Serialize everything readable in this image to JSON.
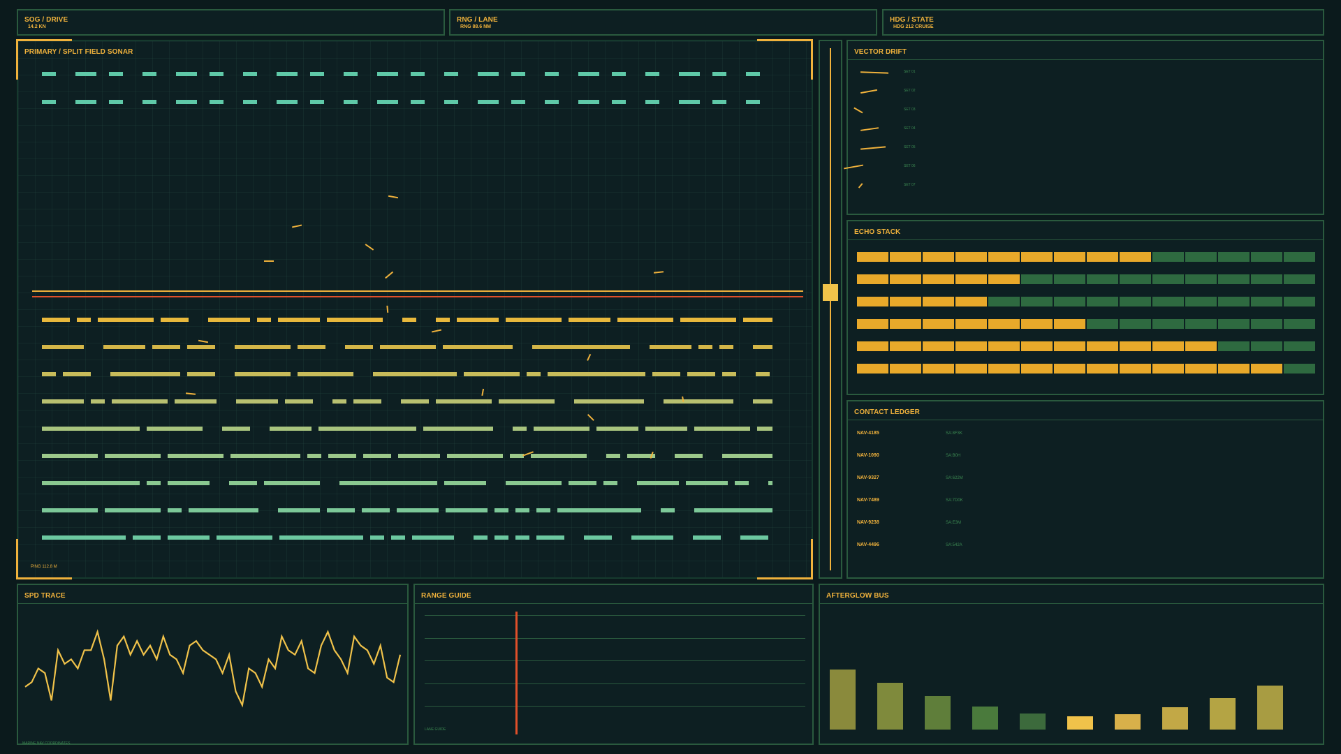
{
  "top_bar": [
    {
      "title": "SOG / DRIVE",
      "value": "14.2 KN"
    },
    {
      "title": "RNG / LANE",
      "value": "RNG 88.6 NM"
    },
    {
      "title": "HDG / STATE",
      "value": "HDG 212 CRUISE"
    }
  ],
  "sonar": {
    "title": "PRIMARY  /  SPLIT FIELD SONAR",
    "footer": "PING 112.8 M"
  },
  "vector_drift": {
    "title": "VECTOR DRIFT",
    "sets": [
      "SET 01",
      "SET 02",
      "SET 03",
      "SET 04",
      "SET 05",
      "SET 06",
      "SET 07"
    ]
  },
  "echo_stack": {
    "title": "ECHO STACK",
    "rows": [
      9,
      5,
      4,
      7,
      11,
      13
    ],
    "total": 14
  },
  "contact_ledger": {
    "title": "CONTACT LEDGER",
    "rows": [
      {
        "id": "NAV-4185",
        "val": "SA:8F3K"
      },
      {
        "id": "NAV-1090",
        "val": "SA:B0H"
      },
      {
        "id": "NAV-9327",
        "val": "SA:622M"
      },
      {
        "id": "NAV-7489",
        "val": "SA:7D0K"
      },
      {
        "id": "NAV-9238",
        "val": "SA:E3M"
      },
      {
        "id": "NAV-4496",
        "val": "SA:542A"
      }
    ]
  },
  "spd_trace": {
    "title": "SPD TRACE",
    "footer": "MARINE NAV COORDINATES",
    "values": [
      4,
      5,
      8,
      7,
      1,
      12,
      9,
      10,
      8,
      12,
      12,
      16,
      10,
      1,
      13,
      15,
      11,
      14,
      11,
      13,
      10,
      15,
      11,
      10,
      7,
      13,
      14,
      12,
      11,
      10,
      7,
      11,
      3,
      0,
      8,
      7,
      4,
      10,
      8,
      15,
      12,
      11,
      14,
      8,
      7,
      13,
      16,
      12,
      10,
      7,
      15,
      13,
      12,
      9,
      13,
      6,
      5,
      11
    ]
  },
  "range_guide": {
    "title": "RANGE GUIDE",
    "footer": "LANE GUIDE",
    "marker_fraction": 0.24
  },
  "afterglow_bus": {
    "title": "AFTERGLOW BUS",
    "values": [
      0.98,
      0.76,
      0.55,
      0.38,
      0.26,
      0.22,
      0.25,
      0.36,
      0.51,
      0.72
    ],
    "colors": [
      "#8a8a3c",
      "#7f8a3c",
      "#5f7e3a",
      "#4a7a3c",
      "#3c6a3c",
      "#f0c24a",
      "#d8b04a",
      "#c2a846",
      "#b4a444",
      "#a89c42"
    ]
  },
  "colors": {
    "accent": "#f0b23c",
    "teal": "#5fc9a8",
    "red": "#e0502a",
    "green_dim": "#2e6a40",
    "border": "#2a5a3e"
  }
}
